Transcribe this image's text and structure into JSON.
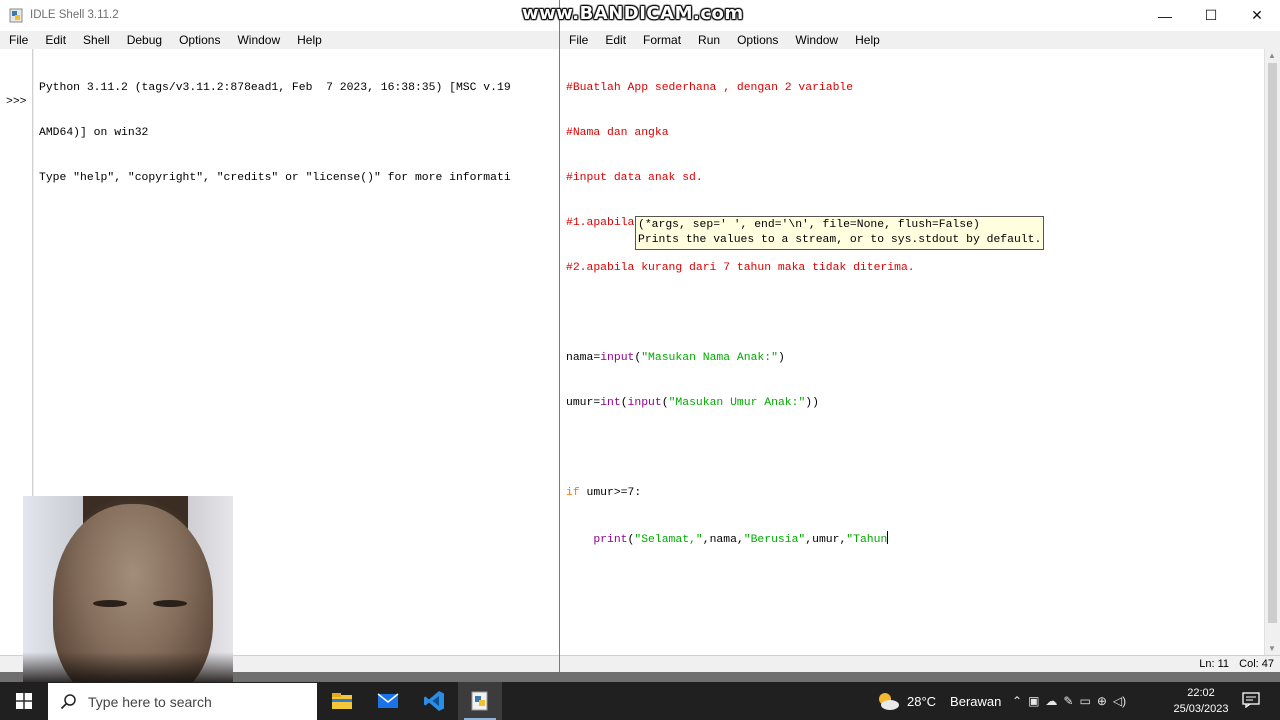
{
  "watermark": "www.BANDICAM.com",
  "shell": {
    "title": "IDLE Shell 3.11.2",
    "menu": [
      "File",
      "Edit",
      "Shell",
      "Debug",
      "Options",
      "Window",
      "Help"
    ],
    "prompt": ">>>",
    "lines": [
      "Python 3.11.2 (tags/v3.11.2:878ead1, Feb  7 2023, 16:38:35) [MSC v.19",
      "AMD64)] on win32",
      "Type \"help\", \"copyright\", \"credits\" or \"license()\" for more informati"
    ]
  },
  "editor": {
    "menu": [
      "File",
      "Edit",
      "Format",
      "Run",
      "Options",
      "Window",
      "Help"
    ],
    "window_buttons": {
      "minimize": "—",
      "maximize": "☐",
      "close": "✕"
    },
    "comments": [
      "#Buatlah App sederhana , dengan 2 variable",
      "#Nama dan angka",
      "#input data anak sd.",
      "#1.apabila umur nya 7 tahun lebih, maka diterima",
      "#2.apabila kurang dari 7 tahun maka tidak diterima."
    ],
    "code": {
      "l7_var": "nama=",
      "l7_fn": "input",
      "l7_open": "(",
      "l7_str": "\"Masukan Nama Anak:\"",
      "l7_close": ")",
      "l8_var": "umur=",
      "l8_fn1": "int",
      "l8_open1": "(",
      "l8_fn2": "input",
      "l8_open2": "(",
      "l8_str": "\"Masukan Umur Anak:\"",
      "l8_close": "))",
      "l10_kw": "if",
      "l10_rest": " umur>=7:",
      "l11_indent": "    ",
      "l11_fn": "print",
      "l11_open": "(",
      "l11_s1": "\"Selamat,\"",
      "l11_mid1": ",nama,",
      "l11_s2": "\"Berusia\"",
      "l11_mid2": ",umur,",
      "l11_s3": "\"Tahun"
    },
    "calltip": [
      "(*args, sep=' ', end='\\n', file=None, flush=False)",
      "Prints the values to a stream, or to sys.stdout by default."
    ],
    "status": {
      "line": "Ln: 11",
      "column": "Col: 47"
    }
  },
  "taskbar": {
    "search_placeholder": "Type here to search",
    "pinned": [
      "file-explorer-icon",
      "mail-icon",
      "vscode-icon",
      "idle-icon"
    ],
    "weather_temp": "28°C",
    "weather_desc": "Berawan",
    "time": "22:02",
    "date": "25/03/2023"
  },
  "colors": {
    "comment": "#dd0000",
    "keyword": "#ff7700",
    "builtin": "#900090",
    "string": "#00aa00",
    "calltip_bg": "#ffffe0",
    "taskbar_bg": "#202020"
  }
}
